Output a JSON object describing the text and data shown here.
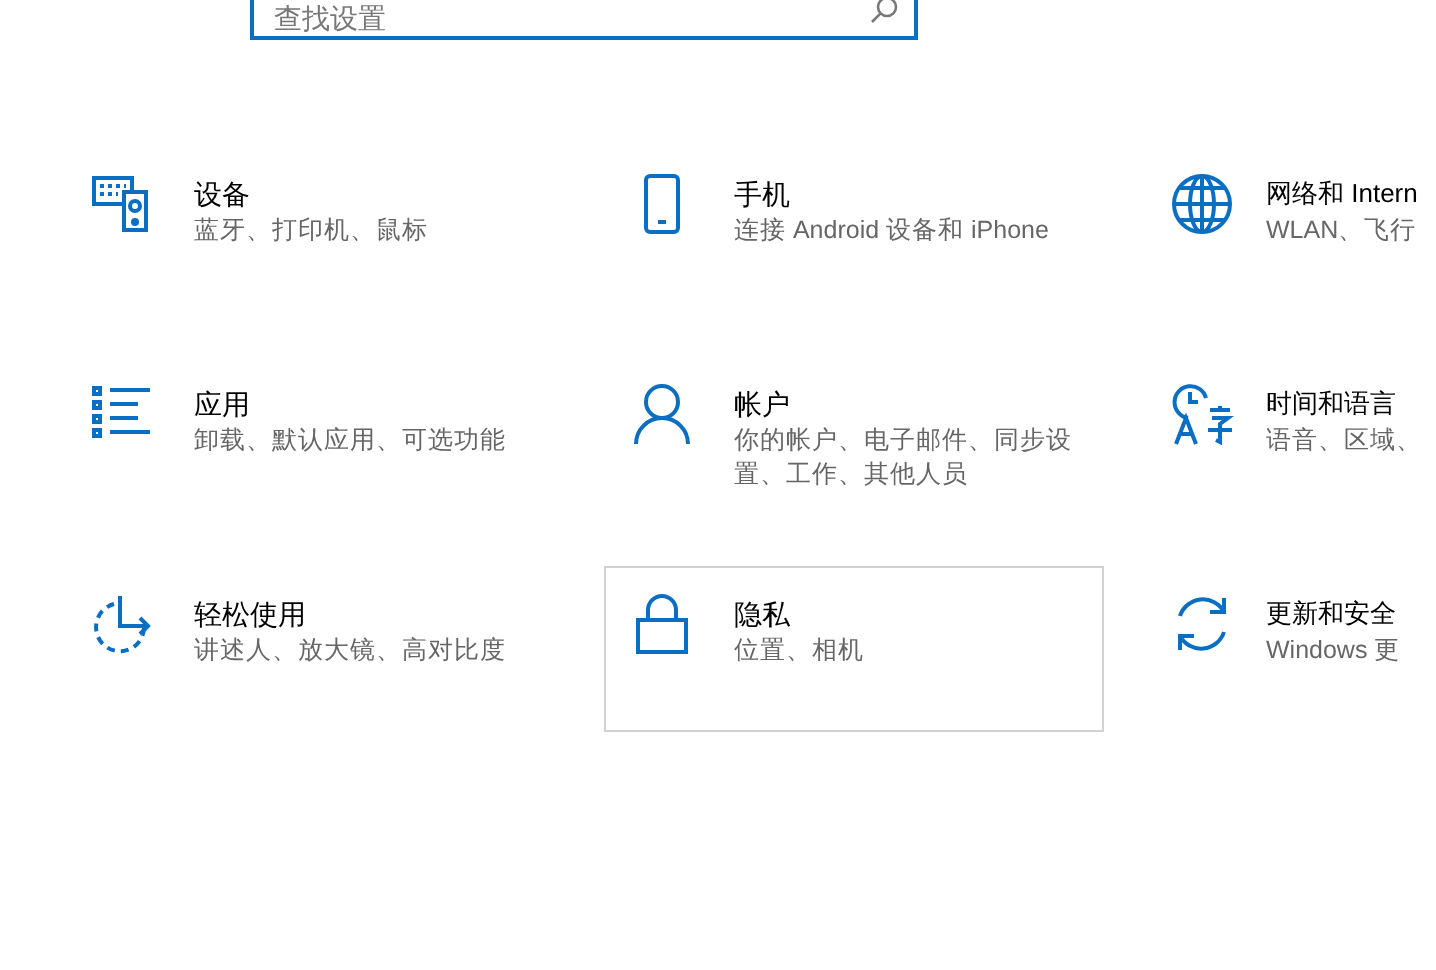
{
  "search": {
    "placeholder": "查找设置"
  },
  "tiles": [
    {
      "kind": "devices",
      "title": "设备",
      "description": "蓝牙、打印机、鼠标",
      "selected": false
    },
    {
      "kind": "phone",
      "title": "手机",
      "description": "连接 Android 设备和 iPhone",
      "selected": false
    },
    {
      "kind": "network",
      "title": "网络和 Intern",
      "description": "WLAN、飞行",
      "selected": false
    },
    {
      "kind": "apps",
      "title": "应用",
      "description": "卸载、默认应用、可选功能",
      "selected": false
    },
    {
      "kind": "accounts",
      "title": "帐户",
      "description": "你的帐户、电子邮件、同步设置、工作、其他人员",
      "selected": false
    },
    {
      "kind": "time",
      "title": "时间和语言",
      "description": "语音、区域、",
      "selected": false
    },
    {
      "kind": "ease",
      "title": "轻松使用",
      "description": "讲述人、放大镜、高对比度",
      "selected": false
    },
    {
      "kind": "privacy",
      "title": "隐私",
      "description": "位置、相机",
      "selected": true
    },
    {
      "kind": "update",
      "title": "更新和安全",
      "description": "Windows 更",
      "selected": false
    }
  ]
}
